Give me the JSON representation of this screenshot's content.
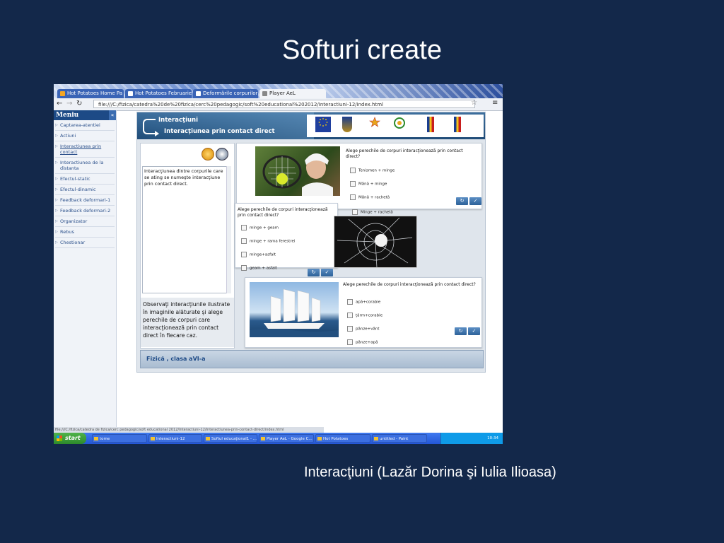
{
  "slide": {
    "title": "Softuri create",
    "caption": "Interacţiuni (Lazăr Dorina şi Iulia Ilioasa)"
  },
  "browser": {
    "tabs": [
      "Hot Potatoes Home Pa",
      "Hot Potatoes Februarie",
      "Deformările corpurilor",
      "Player AeL"
    ],
    "url": "file:///C:/fizica/catedra%20de%20fizica/cerc%20pedagogic/soft%20educational%202012/Interactiuni-12/index.html",
    "status_text": "file:///C:/fizica/catedra de fizica/cerc pedagogic/soft educational 2012/Interactiuni-12/Interactiunea-prin-contact-direct/index.html"
  },
  "sidebar": {
    "title": "Meniu",
    "items": [
      "Captarea-atentiei",
      "Actiuni",
      "Interactiunea prin contact",
      "Interactiunea de la distanta",
      "Efectul-static",
      "Efectul-dinamic",
      "Feedback deformari-1",
      "Feedback deformari-2",
      "Organizator",
      "Rebus",
      "Chestionar"
    ]
  },
  "app": {
    "banner_title": "Interacţiuni",
    "banner_subtitle": "Interacţiunea prin contact direct",
    "left_text": "Interacţiunea dintre corpurile care se ating se numeşte interacţiune prin contact direct.",
    "left_instruction": "Observaţi interacţiunile ilustrate în imaginile alăturate şi alege perechile de corpuri care interacţionează prin contact direct în fiecare caz.",
    "footer": "Fizică , clasa aVI-a",
    "q1": {
      "question": "Alege  perechile de corpuri interacţionează prin contact direct?",
      "options": [
        "Tenismen + minge",
        "Mână + minge",
        "Mână + rachetă",
        "Minge + rachetă"
      ]
    },
    "q2": {
      "question": "Alege  perechile de corpuri interacţionează prin contact direct?",
      "options": [
        "minge + geam",
        "minge + rama ferestrei",
        "minge+asfalt",
        "geam + asfalt"
      ]
    },
    "q3": {
      "question": "Alege perechile de corpuri interacţionează prin contact direct?",
      "options": [
        "apă+corabie",
        "ţărm+corabie",
        "pânze+vânt",
        "pânze+apă"
      ]
    }
  },
  "taskbar": {
    "start": "start",
    "items": [
      "tome",
      "Interactiuni-12",
      "Softul educaţional1 - ...",
      "Player AeL - Google C...",
      "Hot Potatoes",
      "untitled - Paint"
    ],
    "clock": "10:34"
  }
}
